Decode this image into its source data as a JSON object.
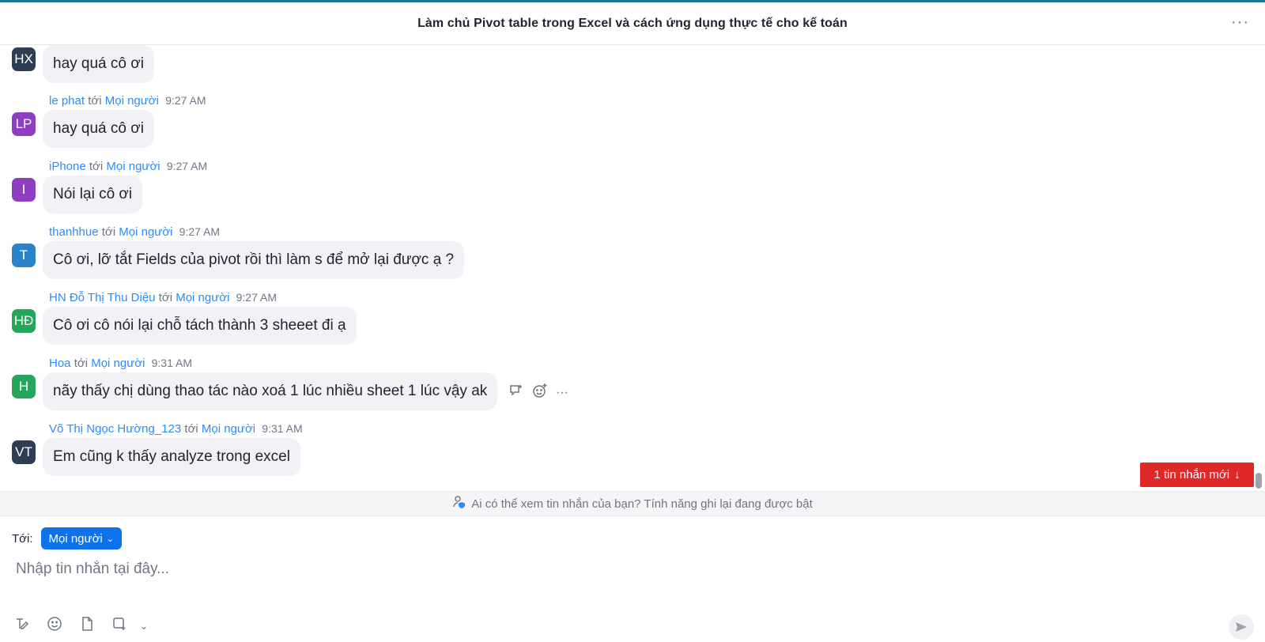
{
  "header": {
    "title": "Làm chủ Pivot table trong Excel và cách ứng dụng thực tế cho kế toán",
    "more_icon": "more-horizontal-icon"
  },
  "messages": [
    {
      "initials": "HX",
      "color": "#2f3d54",
      "show_meta": false,
      "text": "hay quá cô ơi"
    },
    {
      "initials": "LP",
      "color": "#8e3ec0",
      "show_meta": true,
      "sender": "le phat",
      "to_word": "tới",
      "recipient": "Mọi người",
      "time": "9:27 AM",
      "text": "hay quá cô ơi"
    },
    {
      "initials": "I",
      "color": "#8e3ec0",
      "show_meta": true,
      "sender": "iPhone",
      "to_word": "tới",
      "recipient": "Mọi người",
      "time": "9:27 AM",
      "text": "Nói lại cô ơi"
    },
    {
      "initials": "T",
      "color": "#2b82c6",
      "show_meta": true,
      "sender": "thanhhue",
      "to_word": "tới",
      "recipient": "Mọi người",
      "time": "9:27 AM",
      "text": "Cô ơi, lỡ tắt Fields của pivot rồi thì làm s để mở lại được ạ ?"
    },
    {
      "initials": "HĐ",
      "color": "#26a65b",
      "show_meta": true,
      "sender": "HN Đỗ Thị Thu Diệu",
      "to_word": "tới",
      "recipient": "Mọi người",
      "time": "9:27 AM",
      "text": "Cô ơi cô nói lại chỗ tách thành 3 sheeet đi ạ"
    },
    {
      "initials": "H",
      "color": "#26a65b",
      "show_meta": true,
      "sender": "Hoa",
      "to_word": "tới",
      "recipient": "Mọi người",
      "time": "9:31 AM",
      "text": "nãy thấy chị dùng thao tác nào xoá 1 lúc nhiều sheet 1 lúc vậy ak"
    },
    {
      "initials": "VT",
      "color": "#2f3d54",
      "show_meta": true,
      "sender": "Võ Thị Ngọc Hường_123",
      "to_word": "tới",
      "recipient": "Mọi người",
      "time": "9:31 AM",
      "text": "Em cũng k thấy analyze trong excel"
    }
  ],
  "hover_actions": {
    "reply_icon": "reply-icon",
    "react_icon": "emoji-add-icon",
    "more_icon": "more-horizontal-icon"
  },
  "new_message_button": {
    "label": "1 tin nhắn mới",
    "icon": "arrow-down-icon"
  },
  "notice": {
    "text": "Ai có thể xem tin nhắn của bạn? Tính năng ghi lại đang được bật",
    "icon": "user-shield-icon"
  },
  "composer": {
    "to_label": "Tới:",
    "recipient": "Mọi người",
    "placeholder": "Nhập tin nhắn tại đây...",
    "tools": [
      "format-text-icon",
      "emoji-icon",
      "file-icon",
      "screenshot-icon",
      "chevron-down-icon"
    ],
    "send_icon": "send-icon"
  }
}
